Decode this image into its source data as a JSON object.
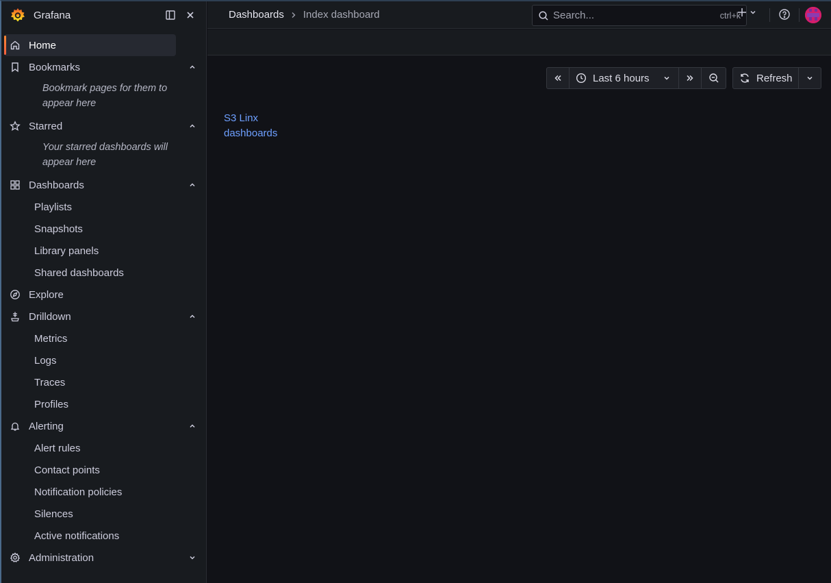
{
  "app": {
    "name": "Grafana"
  },
  "nav": {
    "home": "Home",
    "bookmarks": {
      "label": "Bookmarks",
      "empty": "Bookmark pages for them to appear here"
    },
    "starred": {
      "label": "Starred",
      "empty": "Your starred dashboards will appear here"
    },
    "dashboards": {
      "label": "Dashboards",
      "items": [
        "Playlists",
        "Snapshots",
        "Library panels",
        "Shared dashboards"
      ]
    },
    "explore": "Explore",
    "drilldown": {
      "label": "Drilldown",
      "items": [
        "Metrics",
        "Logs",
        "Traces",
        "Profiles"
      ]
    },
    "alerting": {
      "label": "Alerting",
      "items": [
        "Alert rules",
        "Contact points",
        "Notification policies",
        "Silences",
        "Active notifications"
      ]
    },
    "administration": "Administration"
  },
  "breadcrumb": {
    "parent": "Dashboards",
    "current": "Index dashboard"
  },
  "search": {
    "placeholder": "Search...",
    "shortcut": "ctrl+k"
  },
  "time": {
    "range": "Last 6 hours",
    "refresh": "Refresh"
  },
  "content": {
    "link_line1": "S3 Linx",
    "link_line2": "dashboards"
  },
  "colors": {
    "accent": "#ff8833",
    "link": "#6e9fff",
    "background": "#111217",
    "panel": "#181b1f"
  }
}
